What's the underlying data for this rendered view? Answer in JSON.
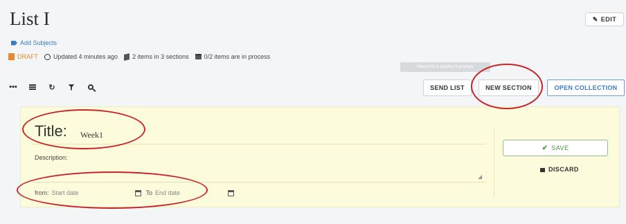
{
  "header": {
    "title": "List I",
    "edit_label": "EDIT",
    "add_subjects": "Add Subjects"
  },
  "meta": {
    "status": "DRAFT",
    "updated": "Updated 4 minutes ago",
    "items_sections": "2 items in 3 sections",
    "in_process": "0/2 items are in process"
  },
  "tooltip": "Select list to display in prompts",
  "toolbar": {
    "more": "•••",
    "refresh": "↻",
    "send_list": "SEND LIST",
    "new_section": "NEW SECTION",
    "open_collection": "OPEN COLLECTION"
  },
  "form": {
    "title_label": "Title:",
    "title_value": "Week1",
    "description_label": "Description:",
    "from_label": "from:",
    "start_placeholder": "Start date",
    "to_label": "To",
    "end_placeholder": "End date",
    "save_label": "SAVE",
    "discard_label": "DISCARD"
  },
  "colors": {
    "panel_bg": "#fcfbdc",
    "accent_blue": "#3b7dc4",
    "draft_orange": "#e58a2e",
    "save_green": "#4a9b3f",
    "annotation_red": "#c8242a"
  }
}
